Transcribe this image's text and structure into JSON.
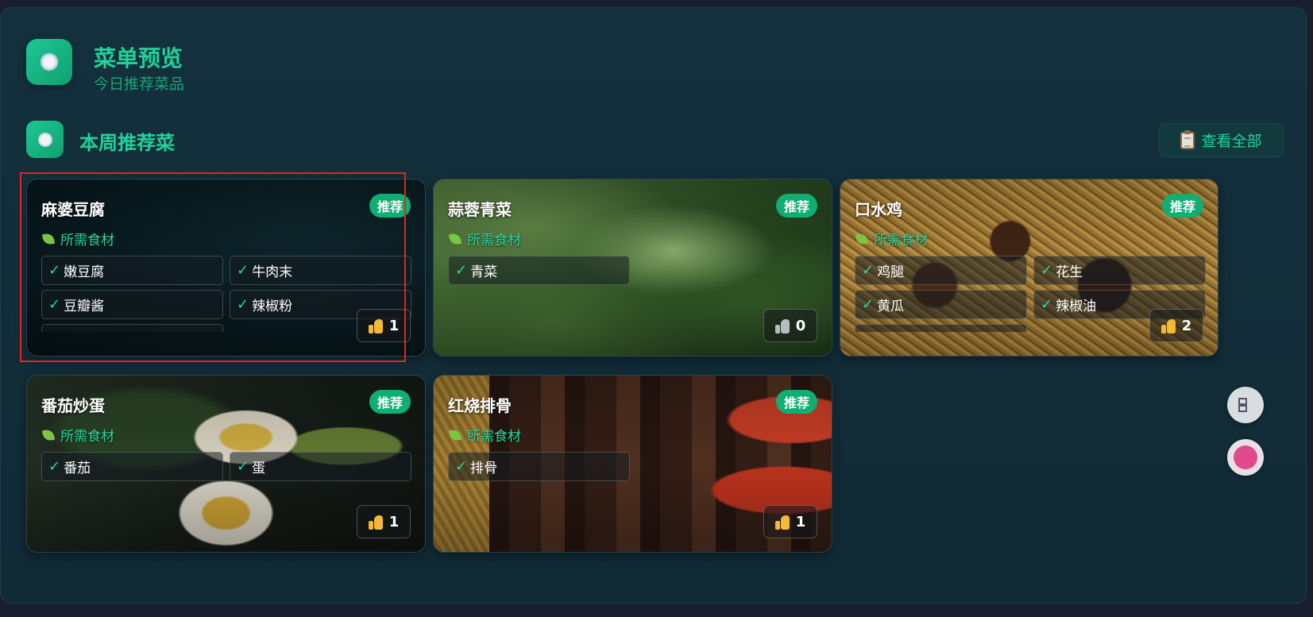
{
  "header": {
    "title": "菜单预览",
    "subtitle": "今日推荐菜品",
    "icon": "plate-icon"
  },
  "section": {
    "title": "本周推荐菜",
    "icon": "plate-icon",
    "view_all_label": "查看全部",
    "view_all_icon": "clipboard-icon"
  },
  "ingredients_heading": "所需食材",
  "check_mark": "✓",
  "dishes": [
    {
      "name": "麻婆豆腐",
      "badge": "推荐",
      "ingredients": [
        "嫩豆腐",
        "牛肉末",
        "豆瓣酱",
        "辣椒粉",
        ""
      ],
      "likes": "1",
      "liked": true
    },
    {
      "name": "蒜蓉青菜",
      "badge": "推荐",
      "ingredients": [
        "青菜"
      ],
      "likes": "0",
      "liked": false
    },
    {
      "name": "口水鸡",
      "badge": "推荐",
      "ingredients": [
        "鸡腿",
        "花生",
        "黄瓜",
        "辣椒油",
        ""
      ],
      "likes": "2",
      "liked": true
    },
    {
      "name": "番茄炒蛋",
      "badge": "推荐",
      "ingredients": [
        "番茄",
        "蛋"
      ],
      "likes": "1",
      "liked": true
    },
    {
      "name": "红烧排骨",
      "badge": "推荐",
      "ingredients": [
        "排骨"
      ],
      "likes": "1",
      "liked": true
    }
  ],
  "colors": {
    "accent": "#1fd39a",
    "badge": "#0fae72",
    "selection": "#e0261e"
  }
}
